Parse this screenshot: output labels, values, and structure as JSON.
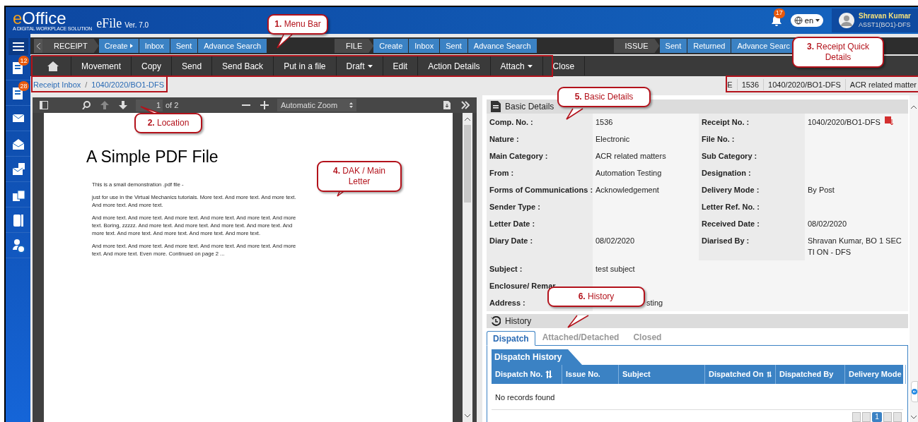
{
  "header": {
    "logo": "eOffice",
    "tagline": "A DIGITAL WORKPLACE SOLUTION",
    "app": "eFile",
    "version": "Ver. 7.0",
    "notifications": "17",
    "language": "en",
    "user_name": "Shravan Kumar",
    "user_role": "ASST1(BO1)-DFS"
  },
  "sidebar": [
    {
      "kind": "receipt",
      "badge": "12"
    },
    {
      "kind": "file",
      "badge": "28"
    },
    {
      "kind": "dak"
    },
    {
      "kind": "inbox"
    },
    {
      "kind": "new"
    },
    {
      "kind": "move"
    },
    {
      "kind": "dsc"
    },
    {
      "kind": "settings"
    }
  ],
  "nav_groups": [
    {
      "label": "RECEIPT",
      "links": [
        {
          "label": "Create",
          "submenu": true
        },
        {
          "label": "Inbox",
          "submenu": false
        },
        {
          "label": "Sent",
          "submenu": false
        },
        {
          "label": "Advance Search",
          "submenu": false
        }
      ]
    },
    {
      "label": "FILE",
      "links": [
        {
          "label": "Create",
          "submenu": false
        },
        {
          "label": "Inbox",
          "submenu": false
        },
        {
          "label": "Sent",
          "submenu": false
        },
        {
          "label": "Advance Search",
          "submenu": false
        }
      ]
    },
    {
      "label": "ISSUE",
      "links": [
        {
          "label": "Sent",
          "submenu": false
        },
        {
          "label": "Returned",
          "submenu": false
        },
        {
          "label": "Advance Searc",
          "submenu": false
        }
      ]
    }
  ],
  "menu_bar": [
    {
      "kind": "home"
    },
    {
      "kind": "button",
      "label": "Movement"
    },
    {
      "kind": "button",
      "label": "Copy"
    },
    {
      "kind": "button",
      "label": "Send"
    },
    {
      "kind": "button",
      "label": "Send Back"
    },
    {
      "kind": "button",
      "label": "Put in a file"
    },
    {
      "kind": "dropdown",
      "label": "Draft"
    },
    {
      "kind": "button",
      "label": "Edit"
    },
    {
      "kind": "button",
      "label": "Action Details"
    },
    {
      "kind": "dropdown",
      "label": "Attach"
    },
    {
      "kind": "button",
      "label": "Close"
    }
  ],
  "breadcrumb": {
    "separator": "/",
    "items": [
      "Receipt Inbox",
      "1040/2020/BO1-DFS"
    ]
  },
  "quick_details": [
    "E",
    "1536",
    "1040/2020/BO1-DFS",
    "ACR related matter"
  ],
  "pdf_viewer": {
    "page": "1",
    "page_count": "of 2",
    "zoom": "Automatic Zoom",
    "title": "A Simple PDF File",
    "paragraphs": [
      "This is a small demonstration .pdf file -",
      "just for use in the Virtual Mechanics tutorials. More text. And more text. And more text. And more text. And more text.",
      "And more text. And more text. And more text. And more text. And more text. And more text. Boring, zzzzz. And more text. And more text. And more text. And more text. And more text. And more text. And more text. And more text. And more text.",
      "And more text. And more text. And more text. And more text. And more text. And more text. And more text. Even more. Continued on page 2 ..."
    ]
  },
  "basic_details": {
    "title": "Basic Details",
    "rows": [
      {
        "label": "Comp. No. :",
        "value": "1536",
        "label2": "Receipt No. :",
        "value2": "1040/2020/BO1-DFS",
        "pdf": true
      },
      {
        "label": "Nature :",
        "value": "Electronic",
        "label2": "File No. :",
        "value2": ""
      },
      {
        "label": "Main Category :",
        "value": "ACR related matters",
        "label2": "Sub Category :",
        "value2": ""
      },
      {
        "label": "From :",
        "value": "Automation Testing",
        "label2": "Designation :",
        "value2": ""
      },
      {
        "label": "Forms of Communications :",
        "value": "Acknowledgement",
        "label2": "Delivery Mode :",
        "value2": "By Post"
      },
      {
        "label": "Sender Type :",
        "value": "",
        "label2": "Letter Ref. No. :",
        "value2": ""
      },
      {
        "label": "Letter Date :",
        "value": "",
        "label2": "Received Date :",
        "value2": "08/02/2020"
      },
      {
        "label": "Diary Date :",
        "value": "08/02/2020",
        "label2": "Diarised By :",
        "value2": "Shravan Kumar, BO 1 SECTI ON - DFS"
      },
      {
        "label": "Subject :",
        "value": "test subject"
      },
      {
        "label": "Enclosure/ Remar",
        "value": ""
      },
      {
        "label": "Address :",
        "value": "sting"
      }
    ]
  },
  "history": {
    "title": "History",
    "tabs": [
      {
        "label": "Dispatch",
        "selected": true
      },
      {
        "label": "Attached/Detached",
        "selected": false
      },
      {
        "label": "Closed",
        "selected": false
      }
    ],
    "section": "Dispatch History",
    "columns": [
      {
        "label": "Dispatch No.",
        "sortable": true
      },
      {
        "label": "Issue No.",
        "sortable": false
      },
      {
        "label": "Subject",
        "sortable": false
      },
      {
        "label": "Dispatched On",
        "sortable": true
      },
      {
        "label": "Dispatched By",
        "sortable": false
      },
      {
        "label": "Delivery Mode",
        "sortable": false
      }
    ],
    "empty": "No records found",
    "page": "1"
  },
  "callouts": [
    {
      "number": "1.",
      "text": "Menu Bar"
    },
    {
      "number": "2.",
      "text": "Location"
    },
    {
      "number": "3.",
      "text": "Receipt Quick Details"
    },
    {
      "number": "4.",
      "text": "DAK / Main Letter"
    },
    {
      "number": "5.",
      "text": "Basic Details"
    },
    {
      "number": "6.",
      "text": "History"
    }
  ]
}
